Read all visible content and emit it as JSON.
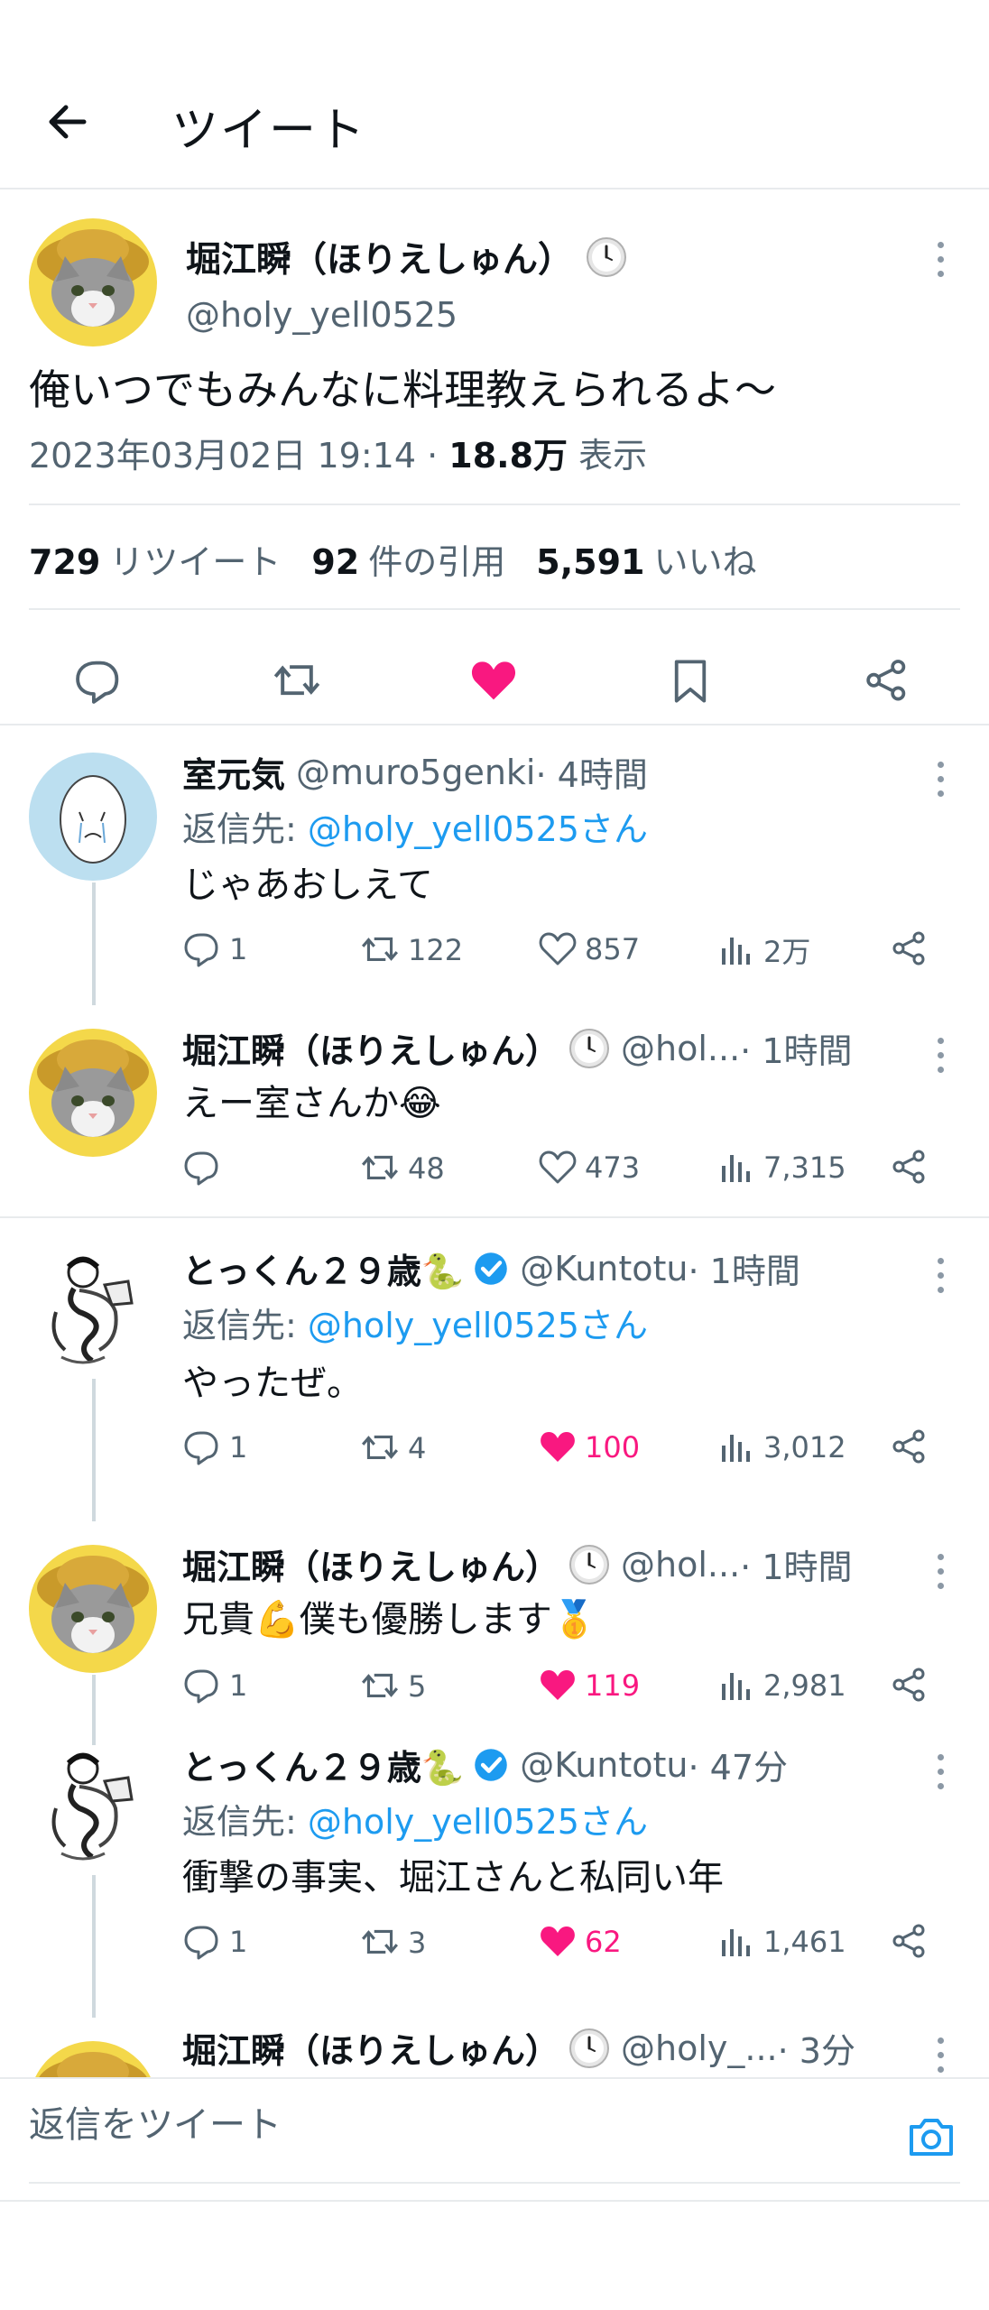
{
  "header": {
    "title": "ツイート",
    "back_icon": "arrow-left-icon"
  },
  "main_tweet": {
    "name": "堀江瞬（ほりえしゅん）",
    "handle": "@holy_yell0525",
    "text": "俺いつでもみんなに料理教えられるよ〜",
    "date": "2023年03月02日 19:14 · ",
    "views_count": "18.8万",
    "views_label": " 表示",
    "retweets_count": "729",
    "retweets_label": "リツイート",
    "quotes_count": "92",
    "quotes_label": "件の引用",
    "likes_count": "5,591",
    "likes_label": "いいね"
  },
  "replies": [
    {
      "name": "室元気",
      "handle": "@muro5genki",
      "time": " · 4時間",
      "reply_to_prefix": "返信先: ",
      "reply_to_handle": "@holy_yell0525さん",
      "text": "じゃあおしえて",
      "replies": "1",
      "retweets": "122",
      "likes": "857",
      "views": "2万",
      "liked": false
    },
    {
      "name": "堀江瞬（ほりえしゅん）",
      "handle": "@hol...",
      "time": " · 1時間",
      "text": "えー室さんか😂",
      "replies": "",
      "retweets": "48",
      "likes": "473",
      "views": "7,315",
      "liked": false
    },
    {
      "name": "とっくん２９歳🐍",
      "handle": "@Kuntotu",
      "time": " · 1時間",
      "reply_to_prefix": "返信先: ",
      "reply_to_handle": "@holy_yell0525さん",
      "text": "やったぜ。",
      "replies": "1",
      "retweets": "4",
      "likes": "100",
      "views": "3,012",
      "liked": true
    },
    {
      "name": "堀江瞬（ほりえしゅん）",
      "handle": "@hol...",
      "time": " · 1時間",
      "text": "兄貴💪僕も優勝します🥇",
      "replies": "1",
      "retweets": "5",
      "likes": "119",
      "views": "2,981",
      "liked": true
    },
    {
      "name": "とっくん２９歳🐍",
      "handle": "@Kuntotu",
      "time": " · 47分",
      "reply_to_prefix": "返信先: ",
      "reply_to_handle": "@holy_yell0525さん",
      "text": "衝撃の事実、堀江さんと私同い年",
      "replies": "1",
      "retweets": "3",
      "likes": "62",
      "views": "1,461",
      "liked": true
    },
    {
      "name": "堀江瞬（ほりえしゅん）",
      "handle": "@holy_...",
      "time": " · 3分"
    }
  ],
  "composer": {
    "placeholder": "返信をツイート",
    "camera_icon": "camera-icon"
  },
  "colors": {
    "accent": "#1d9bf0",
    "like": "#f91880",
    "muted": "#536471",
    "divider": "#e8ebed"
  }
}
